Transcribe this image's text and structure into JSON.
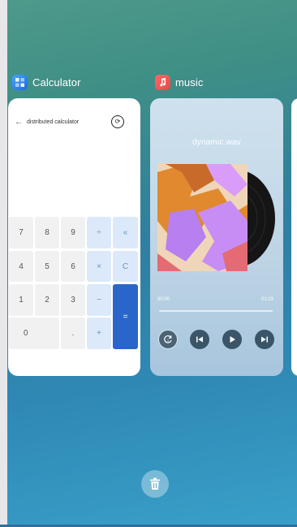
{
  "apps": {
    "calculator": {
      "title": "Calculator",
      "header_text": "distributed calculator",
      "back_glyph": "←",
      "sync_glyph": "⟳",
      "keys": {
        "row1": [
          "7",
          "8",
          "9",
          "÷",
          "«"
        ],
        "row2": [
          "4",
          "5",
          "6",
          "×",
          "C"
        ],
        "row3": [
          "1",
          "2",
          "3",
          "−"
        ],
        "row4": [
          "0",
          ".",
          "+"
        ],
        "equals": "="
      }
    },
    "music": {
      "title": "music",
      "track_name": "dynamic.wav",
      "current_time": "00:00",
      "total_time": "01:03",
      "progress": 0
    }
  },
  "icons": {
    "calculator_app": "calculator-app-icon",
    "music_app": "music-app-icon",
    "trash": "trash-icon"
  },
  "colors": {
    "accent_blue": "#2a66c9",
    "key_op_bg": "#dbe9fa",
    "music_app_red": "#e84545"
  }
}
